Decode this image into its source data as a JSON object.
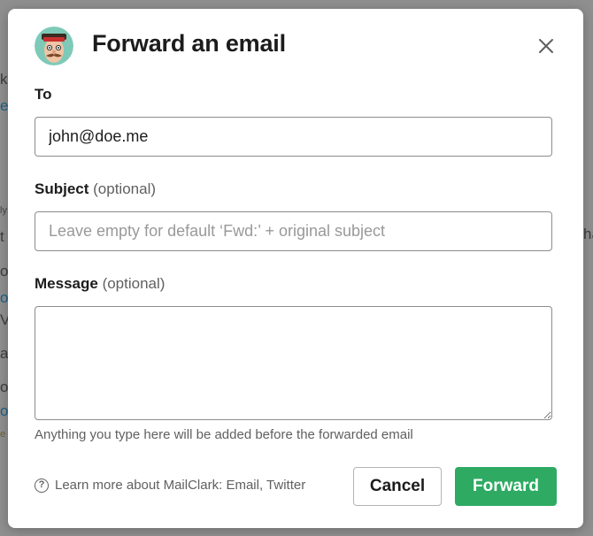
{
  "background": {
    "fragments": [
      "k",
      "e",
      "ly",
      "t",
      "ha",
      "o",
      "o",
      "V",
      "a",
      "o",
      "o",
      "e"
    ]
  },
  "modal": {
    "title": "Forward an email",
    "to": {
      "label": "To",
      "value": "john@doe.me"
    },
    "subject": {
      "label": "Subject",
      "optional": "(optional)",
      "placeholder": "Leave empty for default ‘Fwd:’ + original subject"
    },
    "message": {
      "label": "Message",
      "optional": "(optional)",
      "value": "",
      "hint": "Anything you type here will be added before the forwarded email"
    },
    "footer": {
      "help_prefix": "Learn more about MailClark:",
      "links": [
        "Email",
        "Twitter"
      ],
      "cancel_label": "Cancel",
      "forward_label": "Forward"
    }
  },
  "colors": {
    "primary": "#2eaa63",
    "overlay": "#8f8f8f"
  }
}
